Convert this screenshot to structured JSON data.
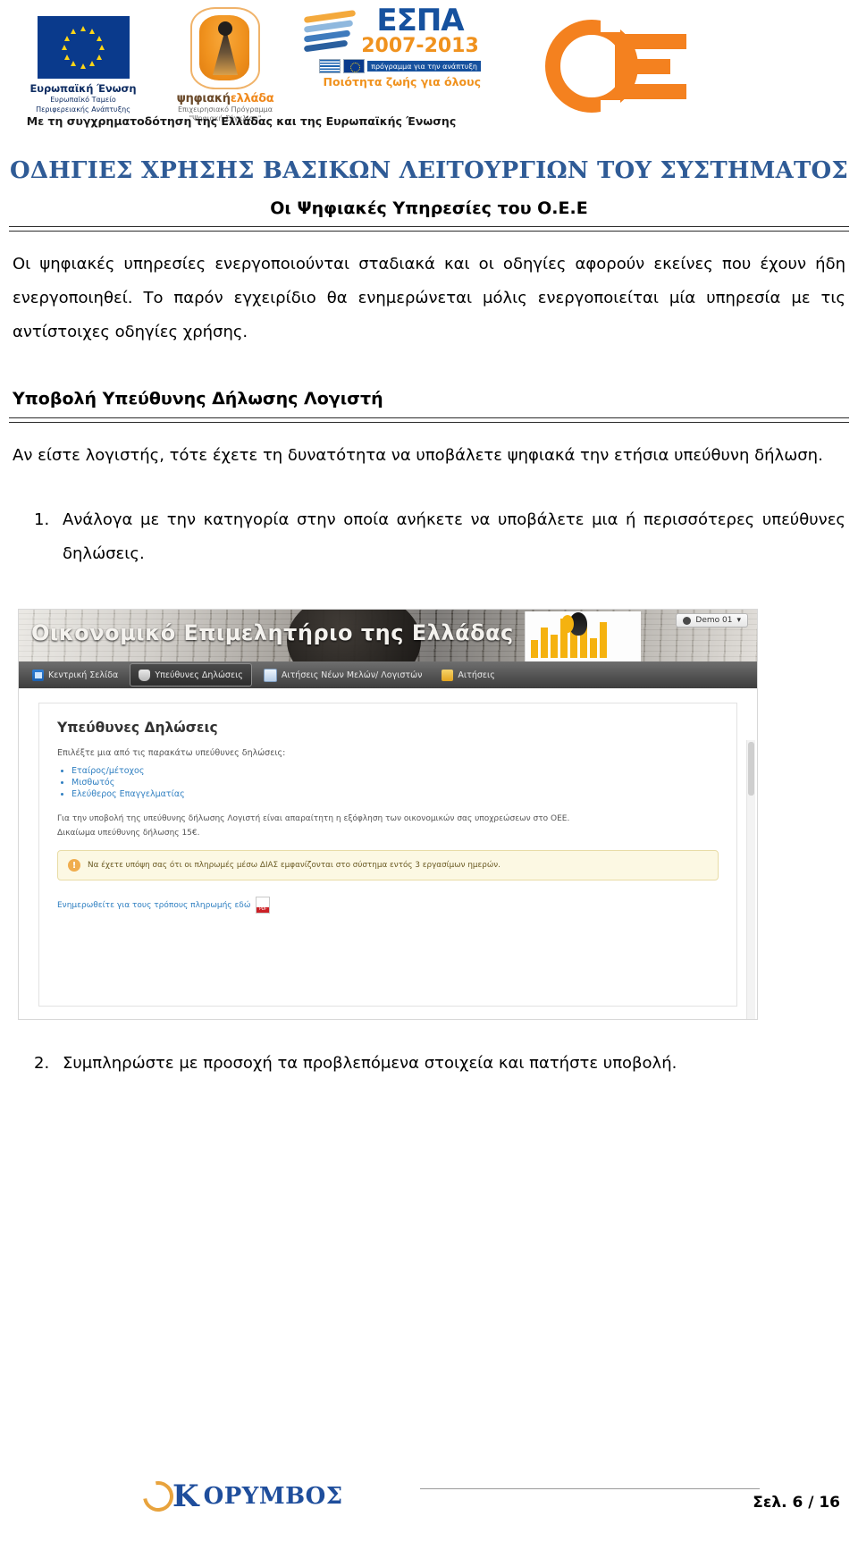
{
  "header": {
    "eu_logo": {
      "title": "Ευρωπαϊκή Ένωση",
      "line2": "Ευρωπαϊκό Ταμείο",
      "line3": "Περιφερειακής Ανάπτυξης"
    },
    "digital_greece_logo": {
      "word_a": "ψηφιακή",
      "word_b": "ελλάδα",
      "line2": "Επιχειρησιακό Πρόγραμμα",
      "line3": "\"Ψηφιακή Σύγκλιση\""
    },
    "espa_logo": {
      "word": "ΕΣΠΑ",
      "years": "2007-2013",
      "tag": "πρόγραμμα για την ανάπτυξη",
      "subtitle": "Ποιότητα ζωής για όλους"
    },
    "oee_logo_name": "oee-logo",
    "funding_line": "Με τη συγχρηματοδότηση της Ελλάδας και της Ευρωπαϊκής Ένωσης"
  },
  "document": {
    "main_title": "ΟΔΗΓΙΕΣ ΧΡΗΣΗΣ ΒΑΣΙΚΩΝ ΛΕΙΤΟΥΡΓΙΩΝ ΤΟΥ ΣΥΣΤΗΜΑΤΟΣ",
    "sub_title": "Οι Ψηφιακές Υπηρεσίες του Ο.Ε.Ε",
    "intro_paragraph": "Οι ψηφιακές υπηρεσίες ενεργοποιούνται σταδιακά και οι οδηγίες αφορούν εκείνες που έχουν ήδη ενεργοποιηθεί. Το παρόν εγχειρίδιο θα ενημερώνεται μόλις ενεργοποιείται μία υπηρεσία με τις αντίστοιχες οδηγίες χρήσης.",
    "section_heading": "Υποβολή Υπεύθυνης Δήλωσης Λογιστή",
    "section_paragraph": "Αν είστε λογιστής, τότε έχετε τη δυνατότητα να υποβάλετε ψηφιακά την ετήσια υπεύθυνη δήλωση.",
    "steps": [
      {
        "num": "1.",
        "text": "Ανάλογα με την κατηγορία στην οποία ανήκετε να υποβάλετε μια ή περισσότερες υπεύθυνες δηλώσεις."
      },
      {
        "num": "2.",
        "text": "Συμπληρώστε με προσοχή τα προβλεπόμενα στοιχεία και πατήστε υποβολή."
      }
    ]
  },
  "screenshot": {
    "banner_title": "Οικονομικό Επιμελητήριο της Ελλάδας",
    "nav": [
      {
        "label": "Κεντρική Σελίδα",
        "icon": "home-icon",
        "active": false
      },
      {
        "label": "Υπεύθυνες Δηλώσεις",
        "icon": "shield-icon",
        "active": true
      },
      {
        "label": "Αιτήσεις Νέων Μελών/ Λογιστών",
        "icon": "card-icon",
        "active": false
      },
      {
        "label": "Αιτήσεις",
        "icon": "doc-icon",
        "active": false
      }
    ],
    "user_label": "Demo 01",
    "panel": {
      "heading": "Υπεύθυνες Δηλώσεις",
      "lead": "Επιλέξτε μια από τις παρακάτω υπεύθυνες δηλώσεις:",
      "links": [
        "Εταίρος/μέτοχος",
        "Μισθωτός",
        "Ελεύθερος Επαγγελματίας"
      ],
      "note": "Για την υποβολή της υπεύθυνης δήλωσης Λογιστή είναι απαραίτητη η εξόφληση των οικονομικών σας υποχρεώσεων στο ΟΕΕ.",
      "note2": "Δικαίωμα υπεύθυνης δήλωσης 15€.",
      "alert": "Να έχετε υπόψη σας ότι οι πληρωμές μέσω ΔΙΑΣ εμφανίζονται στο σύστημα εντός 3 εργασίμων ημερών.",
      "pdf_link": "Ενημερωθείτε για τους τρόπους πληρωμής εδώ"
    }
  },
  "footer": {
    "logo_letter": "Κ",
    "logo_word": "ΟΡΥΜΒΟΣ",
    "page_number": "Σελ. 6 / 16"
  },
  "colors": {
    "title_blue": "#2f5b96",
    "oee_orange": "#f4811f",
    "espa_blue": "#16519e",
    "espa_orange": "#f0921e",
    "link_blue": "#2f7fc1",
    "alert_bg": "#fcf8e3"
  }
}
